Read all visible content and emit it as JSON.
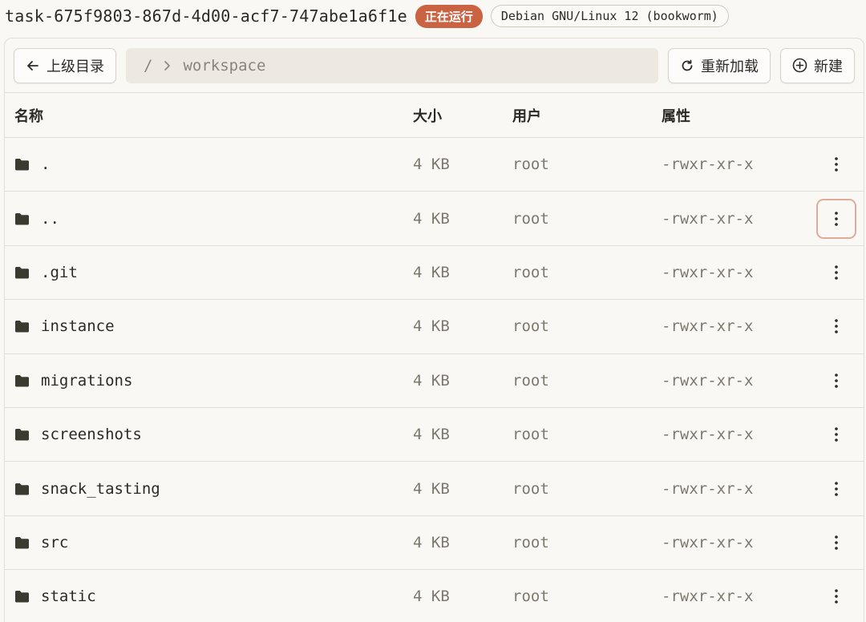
{
  "header": {
    "task_id": "task-675f9803-867d-4d00-acf7-747abe1a6f1e",
    "status": "正在运行",
    "os": "Debian GNU/Linux 12 (bookworm)"
  },
  "toolbar": {
    "back_label": "上级目录",
    "path_root": "/",
    "path_segment": "workspace",
    "reload_label": "重新加载",
    "new_label": "新建"
  },
  "table": {
    "columns": {
      "name": "名称",
      "size": "大小",
      "user": "用户",
      "attributes": "属性"
    },
    "rows": [
      {
        "name": ".",
        "size": "4 KB",
        "user": "root",
        "attributes": "-rwxr-xr-x",
        "icon": "folder-icon"
      },
      {
        "name": "..",
        "size": "4 KB",
        "user": "root",
        "attributes": "-rwxr-xr-x",
        "icon": "folder-icon"
      },
      {
        "name": ".git",
        "size": "4 KB",
        "user": "root",
        "attributes": "-rwxr-xr-x",
        "icon": "folder-icon"
      },
      {
        "name": "instance",
        "size": "4 KB",
        "user": "root",
        "attributes": "-rwxr-xr-x",
        "icon": "folder-icon"
      },
      {
        "name": "migrations",
        "size": "4 KB",
        "user": "root",
        "attributes": "-rwxr-xr-x",
        "icon": "folder-icon"
      },
      {
        "name": "screenshots",
        "size": "4 KB",
        "user": "root",
        "attributes": "-rwxr-xr-x",
        "icon": "folder-icon"
      },
      {
        "name": "snack_tasting",
        "size": "4 KB",
        "user": "root",
        "attributes": "-rwxr-xr-x",
        "icon": "folder-icon"
      },
      {
        "name": "src",
        "size": "4 KB",
        "user": "root",
        "attributes": "-rwxr-xr-x",
        "icon": "folder-icon"
      },
      {
        "name": "static",
        "size": "4 KB",
        "user": "root",
        "attributes": "-rwxr-xr-x",
        "icon": "folder-icon"
      }
    ]
  },
  "colors": {
    "accent": "#c96342",
    "background": "#faf8f4",
    "path_bg": "#ede9e0",
    "focus_ring": "#e0ab9b"
  }
}
